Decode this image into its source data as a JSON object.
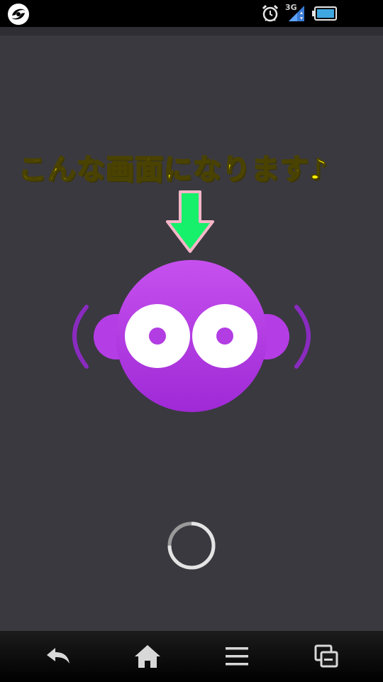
{
  "status_bar": {
    "network_type": "3G",
    "icons": [
      "app-logo-icon",
      "alarm-icon",
      "signal-icon",
      "battery-icon"
    ]
  },
  "annotation": {
    "text": "こんな画面になります♪",
    "text_color": "#fff200",
    "arrow_color": "#17f06a",
    "arrow_outline": "#f7b6c8"
  },
  "mascot": {
    "body_color": "#b53de6",
    "eye_color": "#ffffff",
    "pupil_color": "#b23de3"
  },
  "loading": {
    "icon": "loading-spinner-icon"
  },
  "nav_bar": {
    "buttons": [
      "back-icon",
      "home-icon",
      "menu-icon",
      "recent-apps-icon"
    ]
  }
}
